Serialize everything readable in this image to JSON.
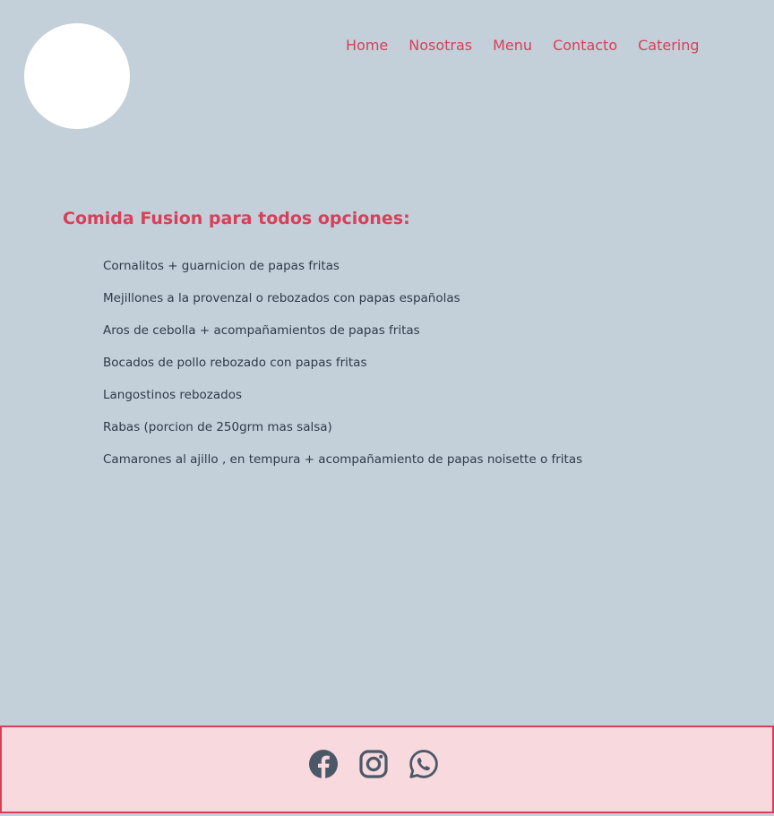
{
  "nav": {
    "items": [
      {
        "label": "Home"
      },
      {
        "label": "Nosotras"
      },
      {
        "label": "Menu"
      },
      {
        "label": "Contacto"
      },
      {
        "label": "Catering"
      }
    ]
  },
  "main": {
    "heading": "Comida Fusion para todos opciones:",
    "items": [
      "Cornalitos + guarnicion de papas fritas",
      "Mejillones a la provenzal o rebozados con papas españolas",
      "Aros de cebolla + acompañamientos de papas fritas",
      "Bocados de pollo rebozado con papas fritas",
      "Langostinos rebozados",
      "Rabas (porcion de 250grm mas salsa)",
      "Camarones al ajillo , en tempura + acompañamiento de papas noisette o fritas"
    ]
  },
  "footer": {
    "socials": [
      {
        "icon": "facebook-icon"
      },
      {
        "icon": "instagram-icon"
      },
      {
        "icon": "whatsapp-icon"
      }
    ]
  },
  "colors": {
    "background": "#c4d0d9",
    "accent": "#d6405a",
    "text": "#2e3a48",
    "footer_bg": "#f7d9de",
    "icon": "#4a5868"
  }
}
